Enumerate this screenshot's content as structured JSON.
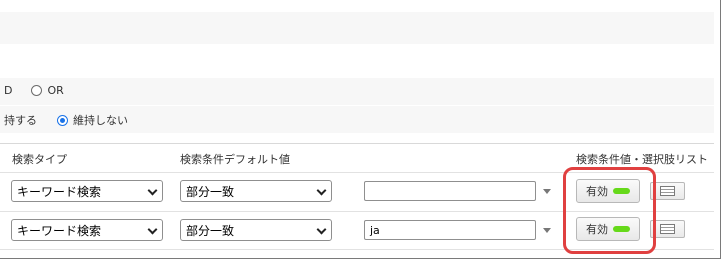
{
  "options": {
    "match_mode": {
      "partial_label": "D",
      "or_label": "OR"
    },
    "retain": {
      "retain_label": "持する",
      "no_retain_label": "維持しない"
    }
  },
  "table": {
    "headers": {
      "search_type": "検索タイプ",
      "default_condition": "検索条件デフォルト値",
      "values_options": "検索条件値・選択肢リスト"
    },
    "rows": [
      {
        "search_type": "キーワード検索",
        "condition": "部分一致",
        "value": "",
        "status": "有効"
      },
      {
        "search_type": "キーワード検索",
        "condition": "部分一致",
        "value": "ja",
        "status": "有効"
      }
    ]
  },
  "colors": {
    "highlight": "#e04040",
    "status_on": "#66d91a",
    "radio_accent": "#1a73e8"
  },
  "icons": {
    "status": "toggle-on-pill-icon",
    "list": "list-icon",
    "dropdown": "chevron-down-icon"
  }
}
